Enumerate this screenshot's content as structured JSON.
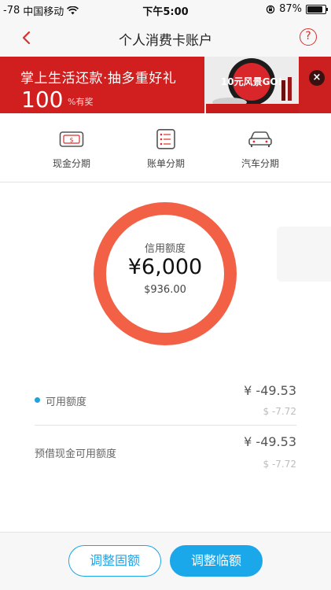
{
  "status_bar": {
    "signal": "-78",
    "carrier": "中国移动",
    "time": "下午5:00",
    "battery_text": "87%",
    "battery_level": 0.87
  },
  "nav": {
    "title": "个人消费卡账户",
    "help_glyph": "?"
  },
  "banner": {
    "title": "掌上生活还款·抽多重好礼",
    "number": "100",
    "unit": "%有奖",
    "art_text": "10元风景GO!",
    "close_glyph": "×"
  },
  "actions": [
    {
      "label": "现金分期",
      "icon": "cash-card-icon"
    },
    {
      "label": "账单分期",
      "icon": "bill-list-icon"
    },
    {
      "label": "汽车分期",
      "icon": "car-icon"
    }
  ],
  "credit": {
    "label": "信用额度",
    "amount": "¥6,000",
    "usd": "$936.00",
    "ring_color": "#f26146"
  },
  "rows": [
    {
      "label": "可用额度",
      "value": "¥ -49.53",
      "sub": "$ -7.72",
      "dot_color": "#1fa2e3"
    },
    {
      "label": "预借现金可用额度",
      "value": "¥ -49.53",
      "sub": "$ -7.72"
    }
  ],
  "buttons": {
    "adjust_fixed": "调整固额",
    "adjust_temp": "调整临额"
  },
  "colors": {
    "accent_red": "#d11e1e",
    "accent_blue": "#1aa8ea"
  }
}
